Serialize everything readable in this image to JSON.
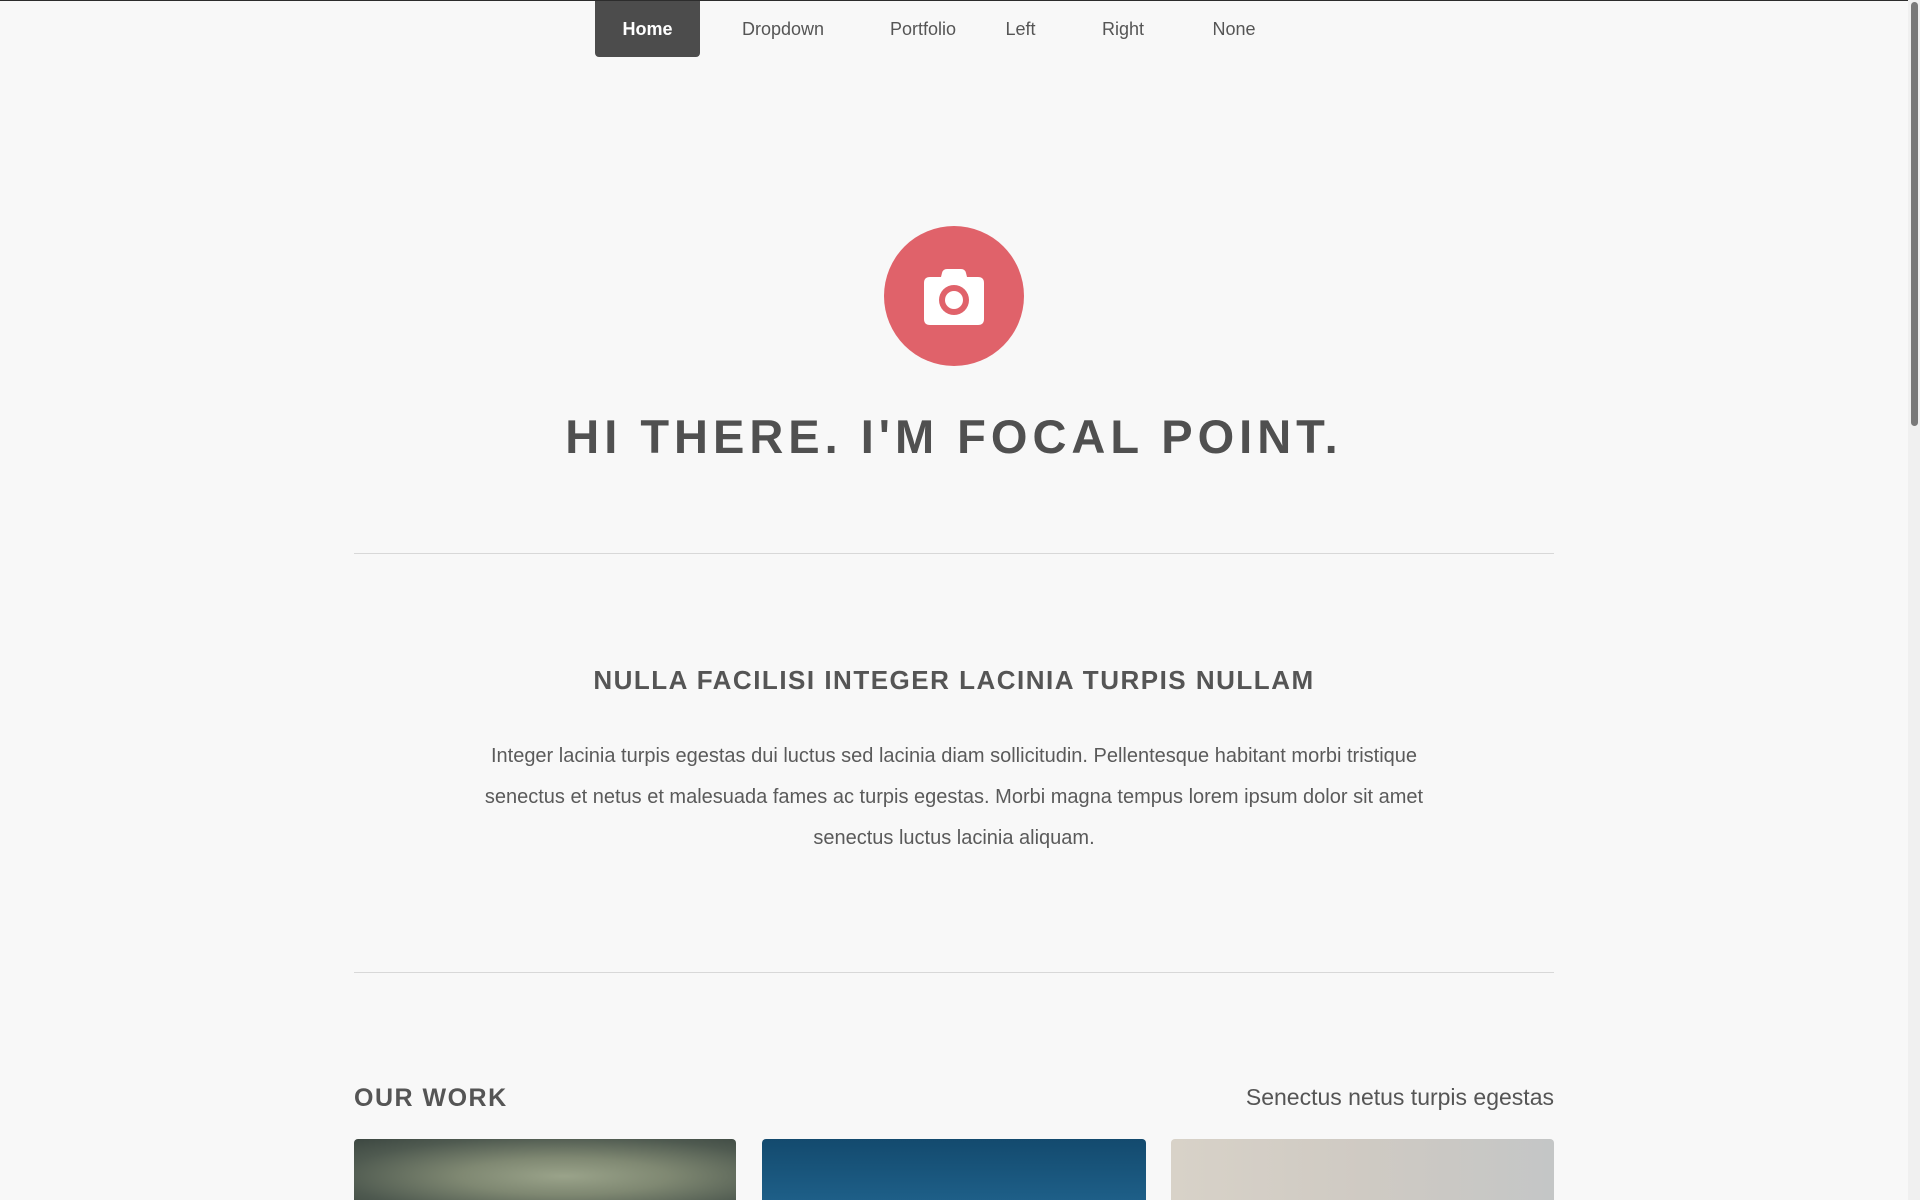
{
  "nav": {
    "items": [
      {
        "label": "Home",
        "active": true
      },
      {
        "label": "Dropdown",
        "active": false
      },
      {
        "label": "Portfolio",
        "active": false
      },
      {
        "label": "Left",
        "active": false
      },
      {
        "label": "Right",
        "active": false
      },
      {
        "label": "None",
        "active": false
      }
    ]
  },
  "hero": {
    "icon": "camera-icon",
    "title": "HI THERE. I'M FOCAL POINT."
  },
  "intro": {
    "heading": "NULLA FACILISI INTEGER LACINIA TURPIS NULLAM",
    "text": "Integer lacinia turpis egestas dui luctus sed lacinia diam sollicitudin. Pellentesque habitant morbi tristique senectus et netus et malesuada fames ac turpis egestas. Morbi magna tempus lorem ipsum dolor sit amet senectus luctus lacinia aliquam."
  },
  "work": {
    "title": "OUR WORK",
    "subtitle": "Senectus netus turpis egestas"
  },
  "colors": {
    "accent": "#e0626a",
    "nav_active_bg": "#4c4c4c",
    "text": "#505050",
    "background": "#f8f8f8"
  }
}
